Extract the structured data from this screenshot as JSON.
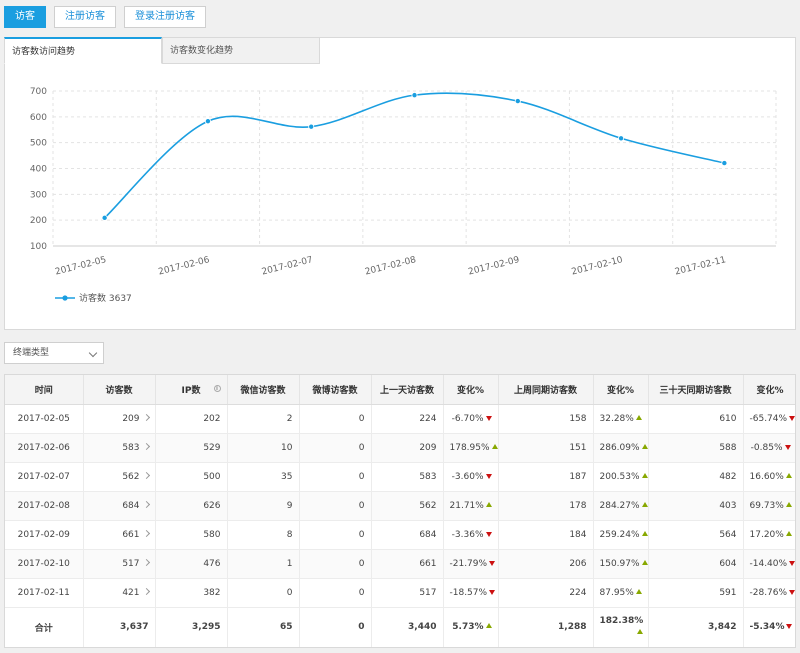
{
  "top_tabs": [
    {
      "label": "访客",
      "active": true
    },
    {
      "label": "注册访客",
      "active": false
    },
    {
      "label": "登录注册访客",
      "active": false
    }
  ],
  "chart_tabs": [
    {
      "label": "访客数访问趋势",
      "active": true
    },
    {
      "label": "访客数变化趋势",
      "active": false
    }
  ],
  "chart_data": {
    "type": "line",
    "x": [
      "2017-02-05",
      "2017-02-06",
      "2017-02-07",
      "2017-02-08",
      "2017-02-09",
      "2017-02-10",
      "2017-02-11"
    ],
    "series": [
      {
        "name": "访客数",
        "values": [
          209,
          583,
          562,
          684,
          661,
          517,
          421
        ]
      }
    ],
    "ylim": [
      100,
      700
    ],
    "yticks": [
      100,
      200,
      300,
      400,
      500,
      600,
      700
    ],
    "legend_text": "访客数 3637",
    "legend_position": "bottom-left",
    "grid": true,
    "color": "#1a9ee0"
  },
  "filter": {
    "label": "终端类型"
  },
  "table": {
    "headers": [
      "时间",
      "访客数",
      "IP数",
      "微信访客数",
      "微博访客数",
      "上一天访客数",
      "变化%",
      "上周同期访客数",
      "变化%",
      "三十天同期访客数",
      "变化%"
    ],
    "rows": [
      {
        "date": "2017-02-05",
        "visitors": "209",
        "ip": "202",
        "wechat": "2",
        "weibo": "0",
        "prev_day": "224",
        "prev_day_change": "-6.70%",
        "prev_day_dir": "down",
        "last_week": "158",
        "last_week_change": "32.28%",
        "last_week_dir": "up",
        "last_30": "610",
        "last_30_change": "-65.74%",
        "last_30_dir": "down"
      },
      {
        "date": "2017-02-06",
        "visitors": "583",
        "ip": "529",
        "wechat": "10",
        "weibo": "0",
        "prev_day": "209",
        "prev_day_change": "178.95%",
        "prev_day_dir": "up",
        "last_week": "151",
        "last_week_change": "286.09%",
        "last_week_dir": "up",
        "last_30": "588",
        "last_30_change": "-0.85%",
        "last_30_dir": "down"
      },
      {
        "date": "2017-02-07",
        "visitors": "562",
        "ip": "500",
        "wechat": "35",
        "weibo": "0",
        "prev_day": "583",
        "prev_day_change": "-3.60%",
        "prev_day_dir": "down",
        "last_week": "187",
        "last_week_change": "200.53%",
        "last_week_dir": "up",
        "last_30": "482",
        "last_30_change": "16.60%",
        "last_30_dir": "up"
      },
      {
        "date": "2017-02-08",
        "visitors": "684",
        "ip": "626",
        "wechat": "9",
        "weibo": "0",
        "prev_day": "562",
        "prev_day_change": "21.71%",
        "prev_day_dir": "up",
        "last_week": "178",
        "last_week_change": "284.27%",
        "last_week_dir": "up",
        "last_30": "403",
        "last_30_change": "69.73%",
        "last_30_dir": "up"
      },
      {
        "date": "2017-02-09",
        "visitors": "661",
        "ip": "580",
        "wechat": "8",
        "weibo": "0",
        "prev_day": "684",
        "prev_day_change": "-3.36%",
        "prev_day_dir": "down",
        "last_week": "184",
        "last_week_change": "259.24%",
        "last_week_dir": "up",
        "last_30": "564",
        "last_30_change": "17.20%",
        "last_30_dir": "up"
      },
      {
        "date": "2017-02-10",
        "visitors": "517",
        "ip": "476",
        "wechat": "1",
        "weibo": "0",
        "prev_day": "661",
        "prev_day_change": "-21.79%",
        "prev_day_dir": "down",
        "last_week": "206",
        "last_week_change": "150.97%",
        "last_week_dir": "up",
        "last_30": "604",
        "last_30_change": "-14.40%",
        "last_30_dir": "down"
      },
      {
        "date": "2017-02-11",
        "visitors": "421",
        "ip": "382",
        "wechat": "0",
        "weibo": "0",
        "prev_day": "517",
        "prev_day_change": "-18.57%",
        "prev_day_dir": "down",
        "last_week": "224",
        "last_week_change": "87.95%",
        "last_week_dir": "up",
        "last_30": "591",
        "last_30_change": "-28.76%",
        "last_30_dir": "down"
      }
    ],
    "total": {
      "label": "合计",
      "visitors": "3,637",
      "ip": "3,295",
      "wechat": "65",
      "weibo": "0",
      "prev_day": "3,440",
      "prev_day_change": "5.73%",
      "prev_day_dir": "up",
      "last_week": "1,288",
      "last_week_change": "182.38%",
      "last_week_dir": "up",
      "last_30": "3,842",
      "last_30_change": "-5.34%",
      "last_30_dir": "down"
    }
  }
}
